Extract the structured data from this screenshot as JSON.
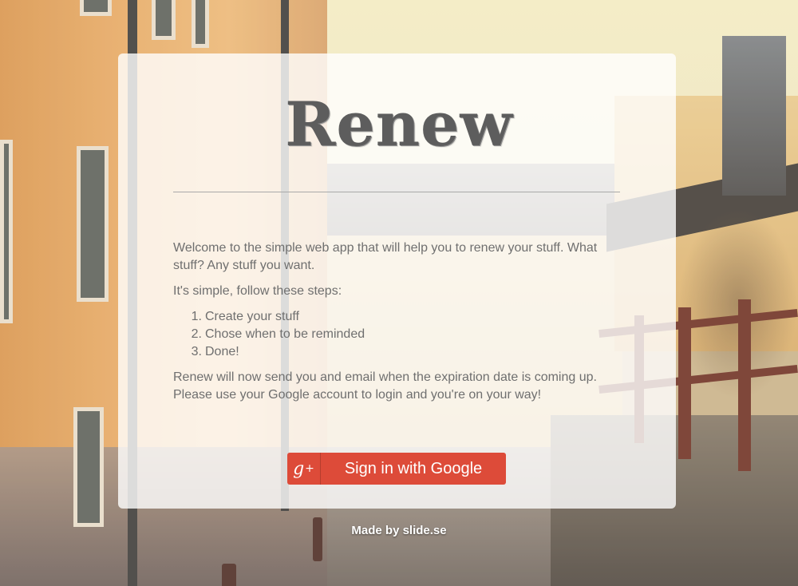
{
  "app": {
    "logo_text": "Renew"
  },
  "intro": {
    "welcome": "Welcome to the simple web app that will help you to renew your stuff. What stuff? Any stuff you want.",
    "steps_heading": "It's simple, follow these steps:",
    "steps": [
      {
        "num": "1.",
        "text": "Create your stuff"
      },
      {
        "num": "2.",
        "text": "Chose when to be reminded"
      },
      {
        "num": "3.",
        "text": "Done!"
      }
    ],
    "outro": "Renew will now send you and email when the expiration date is coming up. Please use your Google account to login and you're on your way!"
  },
  "signin": {
    "icon": "google-plus-icon",
    "icon_text": "g",
    "icon_sup": "+",
    "label": "Sign in with Google",
    "color": "#dd4b39"
  },
  "footer": {
    "credit": "Made by slide.se"
  }
}
